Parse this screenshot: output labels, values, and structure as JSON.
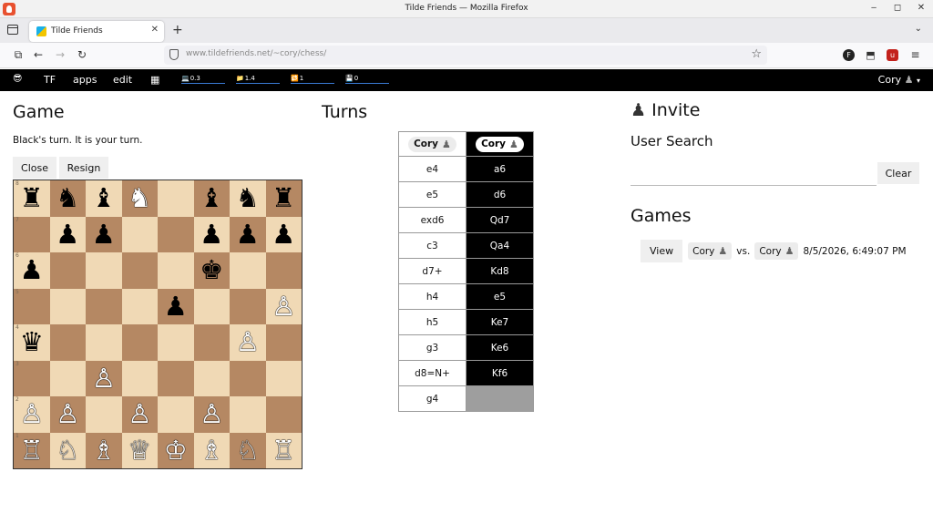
{
  "window": {
    "title": "Tilde Friends — Mozilla Firefox"
  },
  "browser": {
    "tab_title": "Tilde Friends",
    "url": "www.tildefriends.net/~cory/chess/"
  },
  "appbar": {
    "emoji": "😎",
    "items": [
      "TF",
      "apps",
      "edit"
    ],
    "stats": [
      {
        "icon": "💻",
        "value": "0.3"
      },
      {
        "icon": "📁",
        "value": "1.4"
      },
      {
        "icon": "🔁",
        "value": "1"
      },
      {
        "icon": "💾",
        "value": "0"
      }
    ],
    "user": "Cory",
    "user_icon": "♟",
    "user_caret": "▾"
  },
  "game": {
    "heading": "Game",
    "status": "Black's turn. It is your turn.",
    "close_label": "Close",
    "resign_label": "Resign",
    "board": [
      [
        "♜",
        "♞",
        "♝",
        "♞",
        "",
        "♝",
        "♞",
        "♜"
      ],
      [
        "",
        "♟",
        "♟",
        "",
        "",
        "♟",
        "♟",
        "♟"
      ],
      [
        "♟",
        "",
        "",
        "",
        "",
        "♚",
        "",
        ""
      ],
      [
        "",
        "",
        "",
        "",
        "♟",
        "",
        "",
        "♙"
      ],
      [
        "♛",
        "",
        "",
        "",
        "",
        "",
        "♙",
        ""
      ],
      [
        "",
        "",
        "♙",
        "",
        "",
        "",
        "",
        ""
      ],
      [
        "♙",
        "♙",
        "",
        "♙",
        "",
        "♙",
        "",
        ""
      ],
      [
        "♖",
        "♘",
        "♗",
        "♕",
        "♔",
        "♗",
        "♘",
        "♖"
      ]
    ],
    "board_colors": [
      [
        "b",
        "b",
        "b",
        "w",
        "",
        "b",
        "b",
        "b"
      ],
      [
        "",
        "b",
        "b",
        "",
        "",
        "b",
        "b",
        "b"
      ],
      [
        "b",
        "",
        "",
        "",
        "",
        "b",
        "",
        ""
      ],
      [
        "",
        "",
        "",
        "",
        "b",
        "",
        "",
        "w"
      ],
      [
        "b",
        "",
        "",
        "",
        "",
        "",
        "w",
        ""
      ],
      [
        "",
        "",
        "w",
        "",
        "",
        "",
        "",
        ""
      ],
      [
        "w",
        "w",
        "",
        "w",
        "",
        "w",
        "",
        ""
      ],
      [
        "w",
        "w",
        "w",
        "w",
        "w",
        "w",
        "w",
        "w"
      ]
    ],
    "ranks": [
      "8",
      "7",
      "6",
      "5",
      "4",
      "3",
      "2",
      "1"
    ]
  },
  "turns": {
    "heading": "Turns",
    "white_player": "Cory",
    "black_player": "Cory",
    "player_icon": "♟",
    "moves": [
      [
        "e4",
        "a6"
      ],
      [
        "e5",
        "d6"
      ],
      [
        "exd6",
        "Qd7"
      ],
      [
        "c3",
        "Qa4"
      ],
      [
        "d7+",
        "Kd8"
      ],
      [
        "h4",
        "e5"
      ],
      [
        "h5",
        "Ke7"
      ],
      [
        "g3",
        "Ke6"
      ],
      [
        "d8=N+",
        "Kf6"
      ],
      [
        "g4",
        ""
      ]
    ]
  },
  "invite": {
    "heading": "Invite",
    "heading_icon": "♟",
    "user_search_label": "User Search",
    "clear_label": "Clear",
    "search_value": ""
  },
  "games": {
    "heading": "Games",
    "view_label": "View",
    "player1": "Cory",
    "vs_label": "vs.",
    "player2": "Cory",
    "player_icon": "♟",
    "date": "8/5/2026, 6:49:07 PM"
  }
}
